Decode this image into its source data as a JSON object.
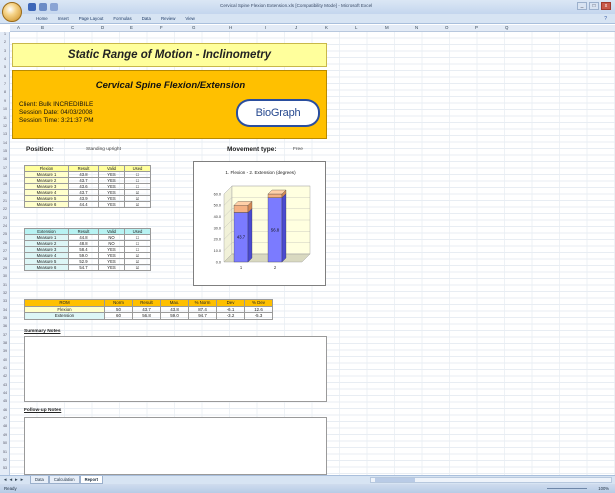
{
  "window": {
    "title": "Cervical Spine Flexion Extension.xls [Compatibility Mode] - Microsoft Excel",
    "tabs": [
      "Home",
      "Insert",
      "Page Layout",
      "Formulas",
      "Data",
      "Review",
      "View"
    ],
    "controls": [
      "_",
      "□",
      "x"
    ]
  },
  "grid": {
    "columns": [
      "A",
      "B",
      "C",
      "D",
      "E",
      "F",
      "G",
      "H",
      "I",
      "J",
      "K",
      "L",
      "M",
      "N",
      "O",
      "P",
      "Q"
    ],
    "rows": [
      "1",
      "2",
      "3",
      "4",
      "5",
      "6",
      "7",
      "8",
      "9",
      "10",
      "11",
      "12",
      "13",
      "14",
      "15",
      "16",
      "17",
      "18",
      "19",
      "20",
      "21",
      "22",
      "23",
      "24",
      "25",
      "26",
      "27",
      "28",
      "29",
      "30",
      "31",
      "32",
      "33",
      "34",
      "35",
      "36",
      "37",
      "38",
      "39",
      "40",
      "41",
      "42",
      "43",
      "44",
      "45",
      "46",
      "47",
      "48",
      "49",
      "50",
      "51",
      "52",
      "53"
    ]
  },
  "report": {
    "title": "Static Range of Motion - Inclinometry",
    "subtitle": "Cervical Spine Flexion/Extension",
    "client": "Client: Bulk INCREDIBILE",
    "session_date": "Session Date: 04/03/2008",
    "session_time": "Session Time: 3:21:37 PM",
    "logo_text": "BioGraph",
    "position_label": "Position:",
    "position_value": "Standing upright",
    "movement_label": "Movement type:",
    "movement_value": "Free"
  },
  "flexion_table": {
    "headers": [
      "Flexion",
      "Result",
      "Valid",
      "Used"
    ],
    "rows": [
      [
        "Measure 1",
        "43.8",
        "YES",
        "☐"
      ],
      [
        "Measure 2",
        "43.7",
        "YES",
        "☐"
      ],
      [
        "Measure 3",
        "43.6",
        "YES",
        "☐"
      ],
      [
        "Measure 4",
        "43.7",
        "YES",
        "☑"
      ],
      [
        "Measure 5",
        "43.9",
        "YES",
        "☑"
      ],
      [
        "Measure 6",
        "44.4",
        "YES",
        "☑"
      ]
    ]
  },
  "extension_table": {
    "headers": [
      "Extension",
      "Result",
      "Valid",
      "Used"
    ],
    "rows": [
      [
        "Measure 1",
        "44.8",
        "NO",
        "☐"
      ],
      [
        "Measure 2",
        "48.8",
        "NO",
        "☐"
      ],
      [
        "Measure 3",
        "58.4",
        "YES",
        "☐"
      ],
      [
        "Measure 4",
        "59.0",
        "YES",
        "☑"
      ],
      [
        "Measure 5",
        "52.9",
        "YES",
        "☑"
      ],
      [
        "Measure 6",
        "54.7",
        "YES",
        "☑"
      ]
    ]
  },
  "rom_table": {
    "headers": [
      "ROM",
      "Norm",
      "Result",
      "Max.",
      "% Norm",
      "Dev",
      "% Dev"
    ],
    "rows": [
      {
        "cls": "flex",
        "cells": [
          "Flexion",
          "50",
          "43.7",
          "43.8",
          "87.4",
          "-6.1",
          "12.6"
        ]
      },
      {
        "cls": "ext",
        "cells": [
          "Extension",
          "60",
          "56.8",
          "59.0",
          "94.7",
          "-3.2",
          "-5.3"
        ]
      }
    ]
  },
  "chart_data": {
    "type": "bar",
    "title": "1. Flexion - 2. Extension (degrees)",
    "categories": [
      "1",
      "2"
    ],
    "series": [
      {
        "values": [
          43.7,
          56.8
        ],
        "color": "#7b7bff"
      },
      {
        "values": [
          6.3,
          3.2
        ],
        "color": "#f4b183"
      }
    ],
    "data_labels": [
      "43.7",
      "56.8"
    ],
    "ylim": [
      0,
      60
    ],
    "yticks": [
      "0.0",
      "10.0",
      "20.0",
      "30.0",
      "40.0",
      "50.0",
      "60.0"
    ],
    "stacked": true,
    "grid": true
  },
  "notes": {
    "summary_label": "Summary Notes",
    "followup_label": "Follow-up Notes"
  },
  "sheets": {
    "nav": "◄ ◄ ► ►",
    "tabs": [
      "Data",
      "Calculation",
      "Report"
    ],
    "active": "Report"
  },
  "status": {
    "ready": "Ready",
    "zoom": "100%"
  }
}
